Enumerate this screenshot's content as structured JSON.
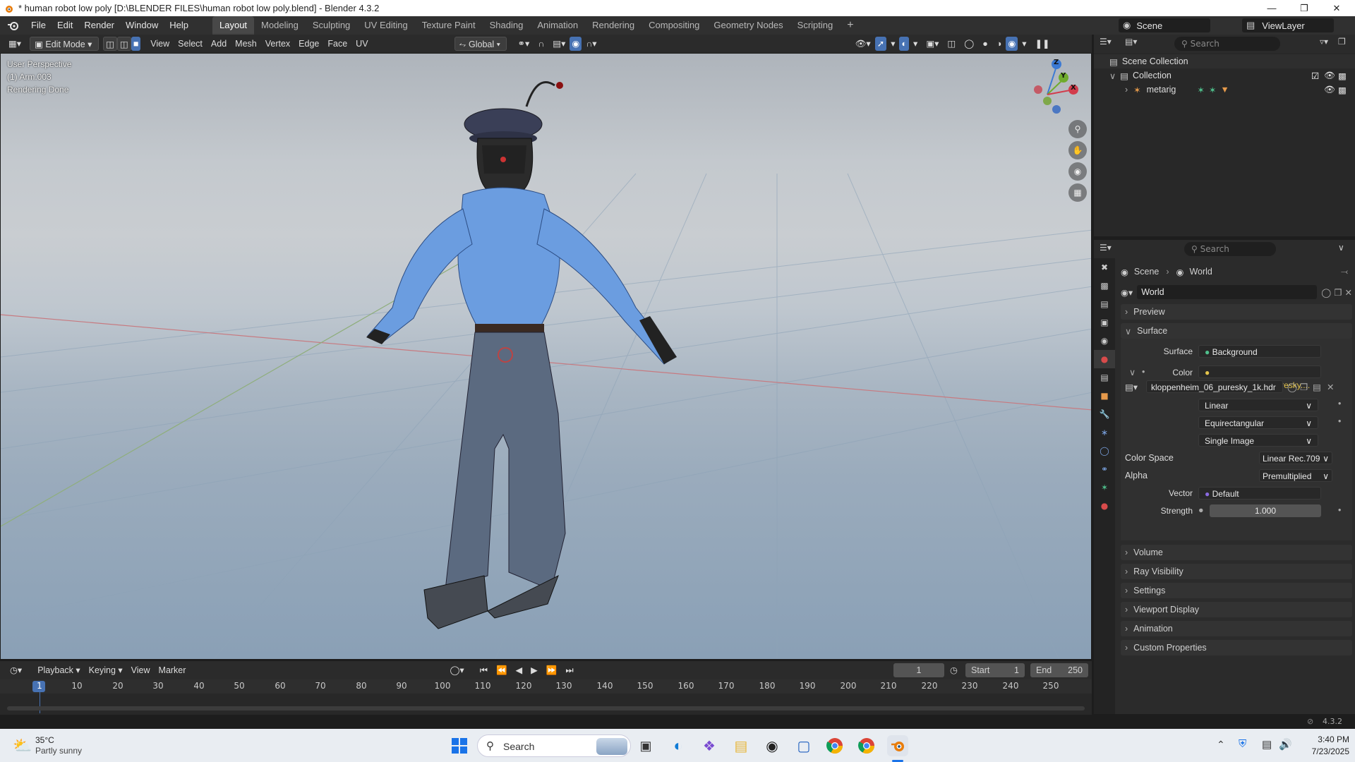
{
  "window": {
    "title": "* human robot low poly [D:\\BLENDER FILES\\human robot low poly.blend] - Blender 4.3.2"
  },
  "menu": {
    "items": [
      "File",
      "Edit",
      "Render",
      "Window",
      "Help"
    ]
  },
  "workspaces": {
    "tabs": [
      "Layout",
      "Modeling",
      "Sculpting",
      "UV Editing",
      "Texture Paint",
      "Shading",
      "Animation",
      "Rendering",
      "Compositing",
      "Geometry Nodes",
      "Scripting"
    ],
    "active": "Layout"
  },
  "scene": {
    "name": "Scene",
    "view_layer": "ViewLayer"
  },
  "viewport_header": {
    "mode": "Edit Mode",
    "menus": [
      "View",
      "Select",
      "Add",
      "Mesh",
      "Vertex",
      "Edge",
      "Face",
      "UV"
    ],
    "orientation": "Global"
  },
  "viewport": {
    "info": [
      "User Perspective",
      "(1) Arm.003",
      "Rendering Done"
    ],
    "gizmo_axes": [
      "Z",
      "Y",
      "X"
    ]
  },
  "outliner": {
    "search_placeholder": "Search",
    "rows": [
      "Scene Collection",
      "Collection",
      "metarig"
    ]
  },
  "properties": {
    "search_placeholder": "Search",
    "breadcrumb": [
      "Scene",
      "World"
    ],
    "world_name": "World",
    "sections": {
      "preview": "Preview",
      "surface": "Surface"
    },
    "surface": {
      "label": "Surface",
      "value": "Background"
    },
    "color": {
      "label": "Color",
      "value": "kloppenheim_06_puresky...."
    },
    "image": {
      "name": "kloppenheim_06_puresky_1k.hdr"
    },
    "interpolation": "Linear",
    "projection": "Equirectangular",
    "source": "Single Image",
    "color_space": {
      "label": "Color Space",
      "value": "Linear Rec.709"
    },
    "alpha": {
      "label": "Alpha",
      "value": "Premultiplied"
    },
    "vector": {
      "label": "Vector",
      "value": "Default"
    },
    "strength": {
      "label": "Strength",
      "value": "1.000"
    },
    "collapsed": [
      "Volume",
      "Ray Visibility",
      "Settings",
      "Viewport Display",
      "Animation",
      "Custom Properties"
    ]
  },
  "timeline": {
    "menus": [
      "Playback",
      "Keying",
      "View",
      "Marker"
    ],
    "current_frame": "1",
    "start_label": "Start",
    "start": "1",
    "end_label": "End",
    "end": "250",
    "ticks": [
      "1",
      "10",
      "20",
      "30",
      "40",
      "50",
      "60",
      "70",
      "80",
      "90",
      "100",
      "110",
      "120",
      "130",
      "140",
      "150",
      "160",
      "170",
      "180",
      "190",
      "200",
      "210",
      "220",
      "230",
      "240",
      "250"
    ]
  },
  "statusbar": {
    "version": "4.3.2"
  },
  "taskbar": {
    "weather_temp": "35°C",
    "weather_desc": "Partly sunny",
    "search_placeholder": "Search",
    "time": "3:40 PM",
    "date": "7/23/2025"
  }
}
